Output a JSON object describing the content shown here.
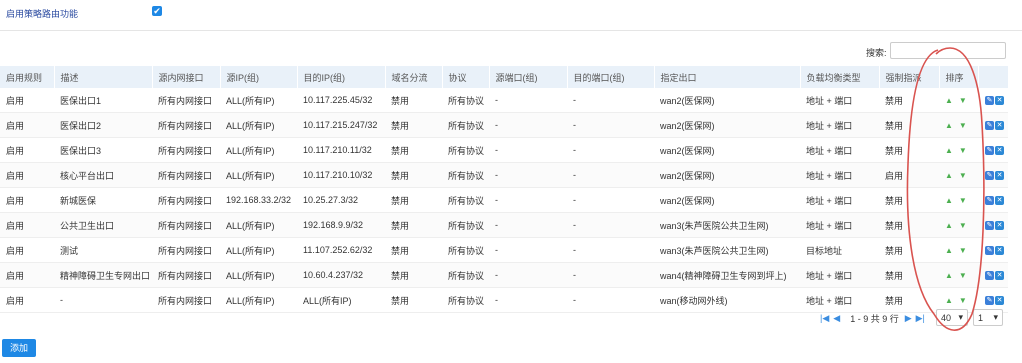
{
  "top": {
    "enable_label": "启用策略路由功能",
    "enable_checked": "✔"
  },
  "search": {
    "label": "搜索:",
    "placeholder": ""
  },
  "table": {
    "headers": [
      "启用规则",
      "描述",
      "源内网接口",
      "源IP(组)",
      "目的IP(组)",
      "域名分流",
      "协议",
      "源端口(组)",
      "目的端口(组)",
      "指定出口",
      "负载均衡类型",
      "强制指派",
      "排序",
      ""
    ],
    "rows": [
      [
        "启用",
        "医保出口1",
        "所有内网接口",
        "ALL(所有IP)",
        "10.117.225.45/32",
        "禁用",
        "所有协议",
        "-",
        "-",
        "wan2(医保网)",
        "地址 + 端口",
        "禁用"
      ],
      [
        "启用",
        "医保出口2",
        "所有内网接口",
        "ALL(所有IP)",
        "10.117.215.247/32",
        "禁用",
        "所有协议",
        "-",
        "-",
        "wan2(医保网)",
        "地址 + 端口",
        "禁用"
      ],
      [
        "启用",
        "医保出口3",
        "所有内网接口",
        "ALL(所有IP)",
        "10.117.210.11/32",
        "禁用",
        "所有协议",
        "-",
        "-",
        "wan2(医保网)",
        "地址 + 端口",
        "禁用"
      ],
      [
        "启用",
        "核心平台出口",
        "所有内网接口",
        "ALL(所有IP)",
        "10.117.210.10/32",
        "禁用",
        "所有协议",
        "-",
        "-",
        "wan2(医保网)",
        "地址 + 端口",
        "启用"
      ],
      [
        "启用",
        "新城医保",
        "所有内网接口",
        "192.168.33.2/32",
        "10.25.27.3/32",
        "禁用",
        "所有协议",
        "-",
        "-",
        "wan2(医保网)",
        "地址 + 端口",
        "禁用"
      ],
      [
        "启用",
        "公共卫生出口",
        "所有内网接口",
        "ALL(所有IP)",
        "192.168.9.9/32",
        "禁用",
        "所有协议",
        "-",
        "-",
        "wan3(朱芦医院公共卫生网)",
        "地址 + 端口",
        "禁用"
      ],
      [
        "启用",
        "测试",
        "所有内网接口",
        "ALL(所有IP)",
        "11.107.252.62/32",
        "禁用",
        "所有协议",
        "-",
        "-",
        "wan3(朱芦医院公共卫生网)",
        "目标地址",
        "禁用"
      ],
      [
        "启用",
        "精神障碍卫生专网出口",
        "所有内网接口",
        "ALL(所有IP)",
        "10.60.4.237/32",
        "禁用",
        "所有协议",
        "-",
        "-",
        "wan4(精神障碍卫生专网到坪上)",
        "地址 + 端口",
        "禁用"
      ],
      [
        "启用",
        "-",
        "所有内网接口",
        "ALL(所有IP)",
        "ALL(所有IP)",
        "禁用",
        "所有协议",
        "-",
        "-",
        "wan(移动网外线)",
        "地址 + 端口",
        "禁用"
      ]
    ]
  },
  "icons": {
    "up": "up-arrow-icon",
    "down": "down-arrow-icon",
    "edit": "edit-icon",
    "delete": "delete-icon"
  },
  "pager": {
    "info": "1 - 9 共 9 行",
    "page_size": "40",
    "page": "1"
  },
  "add_button": "添加",
  "colors": {
    "accent": "#1e88e5",
    "header_bg": "#e9f1f9",
    "annotation": "#d9534f"
  }
}
